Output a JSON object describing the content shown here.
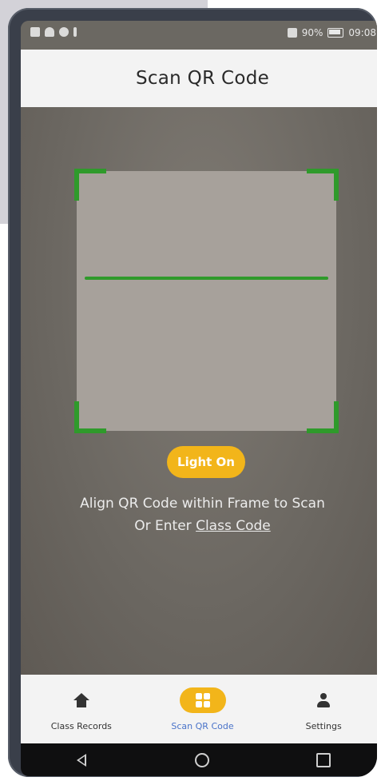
{
  "status_bar": {
    "left_icons": [
      "notification-icon",
      "wifi-icon",
      "sync-icon",
      "alert-icon"
    ],
    "right": {
      "battery_text": "90%",
      "time": "09:08"
    }
  },
  "header": {
    "title": "Scan QR Code"
  },
  "scanner": {
    "light_button_label": "Light On",
    "instruction_line1": "Align QR Code within Frame to Scan",
    "instruction_prefix": "Or Enter ",
    "class_code_link": "Class Code"
  },
  "bottom_nav": {
    "items": [
      {
        "label": "Class Records",
        "icon": "home-icon",
        "active": false
      },
      {
        "label": "Scan QR Code",
        "icon": "qr-code-icon",
        "active": true
      },
      {
        "label": "Settings",
        "icon": "person-icon",
        "active": false
      }
    ]
  },
  "colors": {
    "accent": "#f2b51a",
    "frame_green": "#2f9a2b",
    "active_nav_text": "#4a73c9"
  }
}
